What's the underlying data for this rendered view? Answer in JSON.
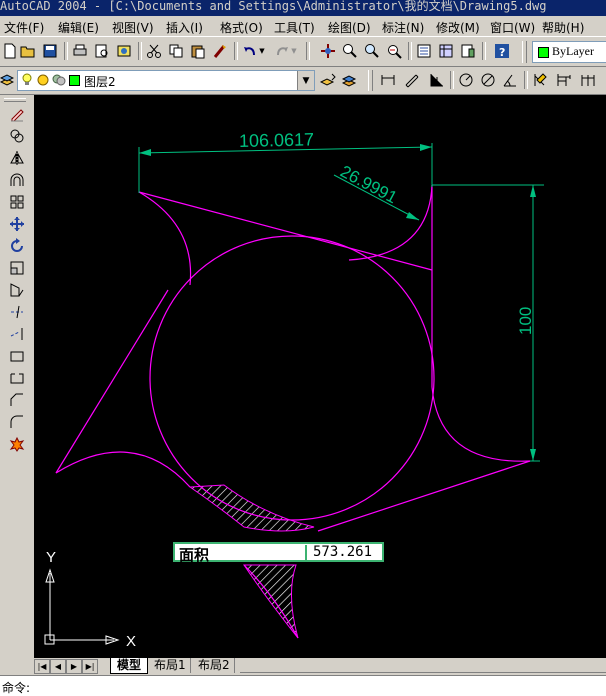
{
  "title": "AutoCAD 2004 - [C:\\Documents and Settings\\Administrator\\我的文档\\Drawing5.dwg",
  "menu": [
    "文件(F)",
    "编辑(E)",
    "视图(V)",
    "插入(I)",
    "格式(O)",
    "工具(T)",
    "绘图(D)",
    "标注(N)",
    "修改(M)",
    "窗口(W)",
    "帮助(H)"
  ],
  "layer": {
    "name": "图层2"
  },
  "color_control": {
    "value": "ByLayer"
  },
  "dimensions": {
    "top": "106.0617",
    "angled": "26.9991",
    "right": "100"
  },
  "tooltip": {
    "label": "面积",
    "value": "573.261"
  },
  "ucs": {
    "x": "X",
    "y": "Y"
  },
  "tabs": [
    "模型",
    "布局1",
    "布局2"
  ],
  "command": {
    "prompt": "命令:"
  },
  "colors": {
    "magenta": "#ff00ff",
    "dimension": "#00c080",
    "canvas": "#000000",
    "title": "#0a246a"
  }
}
